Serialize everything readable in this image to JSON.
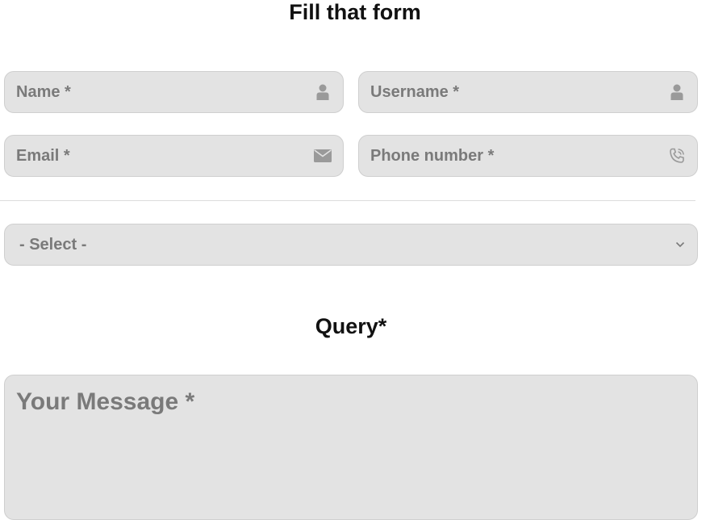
{
  "form": {
    "title": "Fill that form",
    "name": {
      "placeholder": "Name *",
      "icon": "user-icon"
    },
    "username": {
      "placeholder": "Username *",
      "icon": "user-icon"
    },
    "email": {
      "placeholder": "Email *",
      "icon": "envelope-icon"
    },
    "phone": {
      "placeholder": "Phone number *",
      "icon": "phone-icon"
    },
    "select": {
      "selected": "- Select -",
      "icon": "chevron-down-icon"
    },
    "query_label": "Query*",
    "message": {
      "placeholder": "Your Message *"
    }
  },
  "colors": {
    "field_bg": "#e3e3e3",
    "field_border": "#cfcfcf",
    "placeholder": "#7a7a7a",
    "icon": "#9a9a9a",
    "heading": "#111111"
  }
}
